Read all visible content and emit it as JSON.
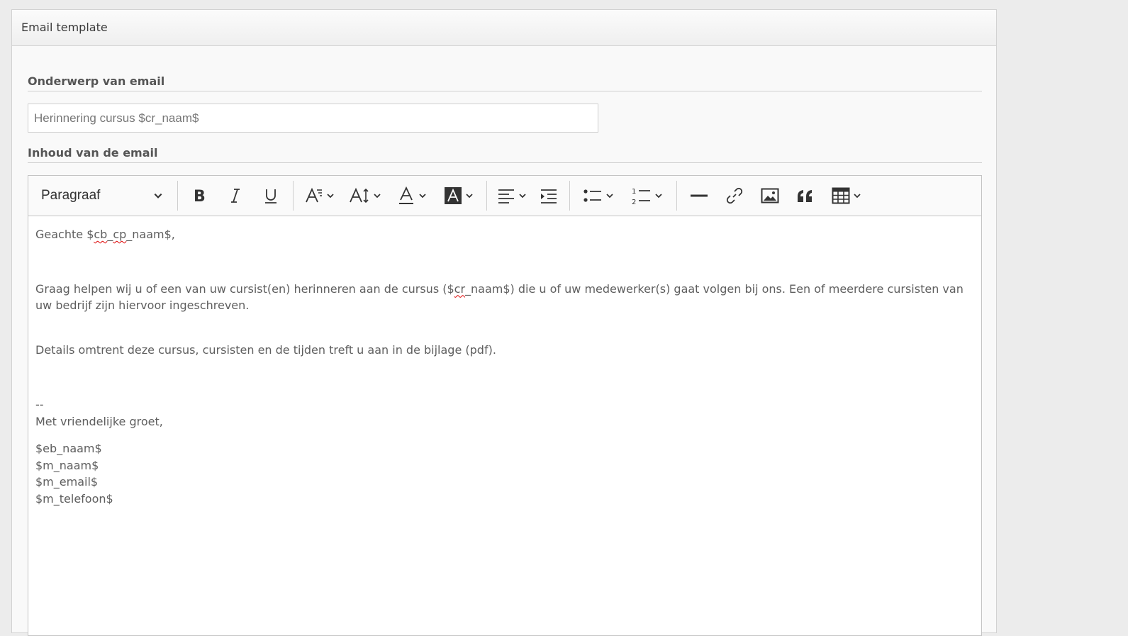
{
  "panel": {
    "title": "Email template"
  },
  "subject": {
    "label": "Onderwerp van email",
    "value": "Herinnering cursus $cr_naam$"
  },
  "body_section": {
    "label": "Inhoud van de email"
  },
  "toolbar": {
    "paragraph_label": "Paragraaf",
    "buttons": [
      "bold",
      "italic",
      "underline",
      "font-size",
      "line-height",
      "font-color",
      "background-color",
      "alignment",
      "indent",
      "bulleted-list",
      "numbered-list",
      "horizontal-line",
      "link",
      "image",
      "block-quote",
      "table"
    ]
  },
  "email_body": {
    "greeting_pre": "Geachte $",
    "greeting_err1": "cb",
    "greeting_mid": "_",
    "greeting_err2": "cp",
    "greeting_post": "_naam$,",
    "para1_pre": "Graag helpen wij u of een van uw cursist(en) herinneren aan de cursus ($",
    "para1_err": "cr",
    "para1_post": "_naam$) die u of uw medewerker(s) gaat volgen bij ons. Een of meerdere cursisten van uw bedrijf zijn hiervoor ingeschreven.",
    "para2": "Details omtrent deze cursus, cursisten en de tijden treft u aan in de bijlage (pdf).",
    "dashes": "--",
    "closing": "Met vriendelijke groet,",
    "signature": [
      "$eb_naam$",
      "$m_naam$",
      "$m_email$",
      "$m_telefoon$"
    ]
  }
}
